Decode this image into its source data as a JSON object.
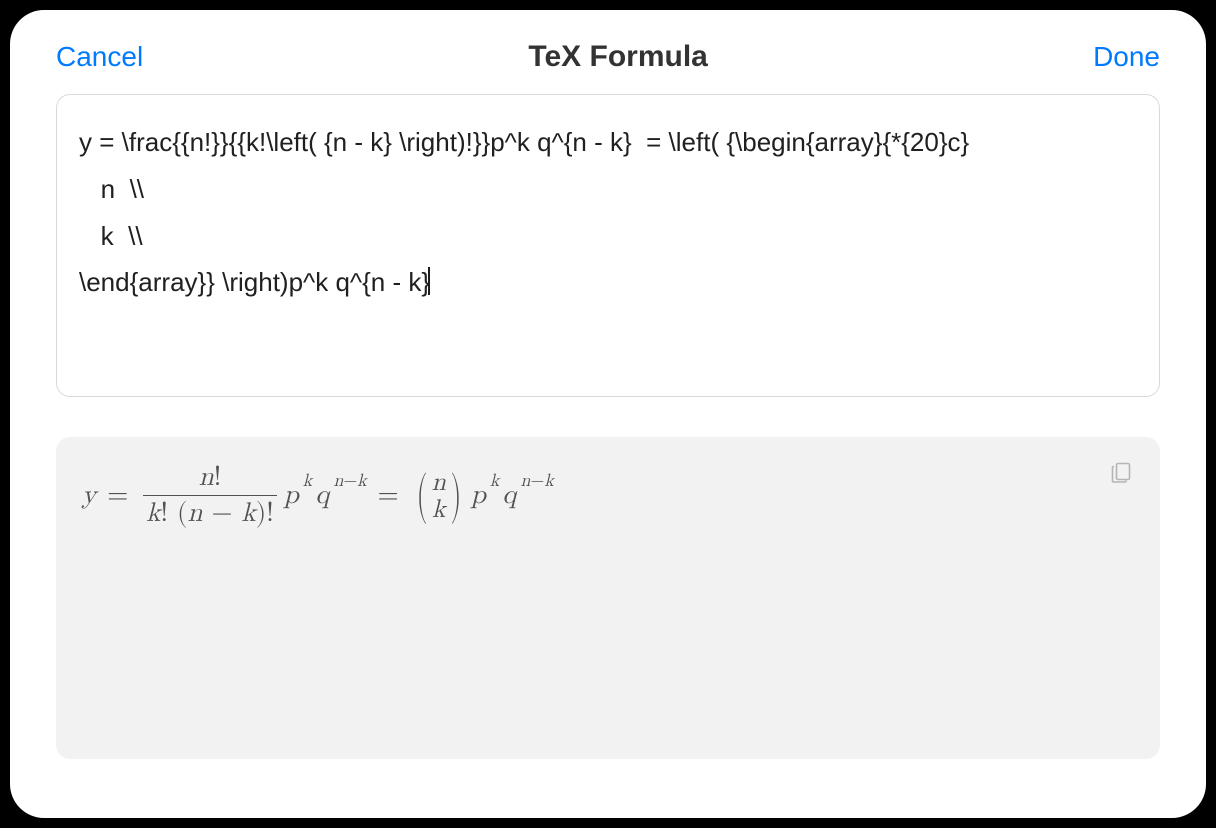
{
  "header": {
    "cancel": "Cancel",
    "title": "TeX Formula",
    "done": "Done"
  },
  "editor": {
    "lines": [
      "y = \\frac{{n!}}{{k!\\left( {n - k} \\right)!}}p^k q^{n - k}  = \\left( {\\begin{array}{*{20}c}",
      "   n  \\\\",
      "   k  \\\\",
      "\\end{array}} \\right)p^k q^{n - k}"
    ]
  },
  "preview": {
    "formula_tex": "y = \\frac{n!}{k!\\,(n-k)!} p^{k} q^{n-k} = \\binom{n}{k} p^{k} q^{n-k}"
  }
}
